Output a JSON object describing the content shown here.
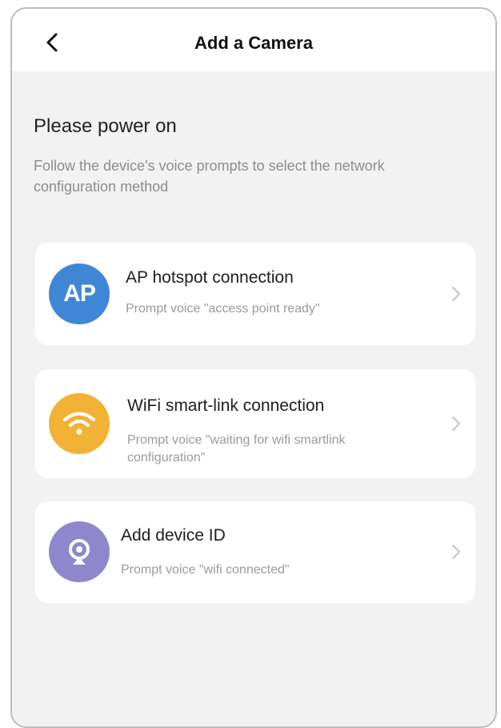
{
  "header": {
    "title": "Add a Camera",
    "back_icon": "chevron-left-icon"
  },
  "main": {
    "heading": "Please power on",
    "description": "Follow the device's voice prompts to select the network configuration method"
  },
  "options": [
    {
      "icon_label": "AP",
      "icon": "ap-icon",
      "icon_color": "#3f86d6",
      "title": "AP hotspot connection",
      "subtitle": "Prompt voice \"access point ready\""
    },
    {
      "icon": "wifi-icon",
      "icon_color": "#f2b235",
      "title": "WiFi smart-link connection",
      "subtitle": "Prompt voice \"waiting for wifi smartlink configuration\""
    },
    {
      "icon": "camera-icon",
      "icon_color": "#8f87cc",
      "title": "Add device ID",
      "subtitle": "Prompt voice \"wifi connected\""
    }
  ],
  "colors": {
    "background": "#f2f2f2",
    "card": "#ffffff",
    "title_text": "#111111",
    "secondary_text": "#9a9a9a"
  }
}
